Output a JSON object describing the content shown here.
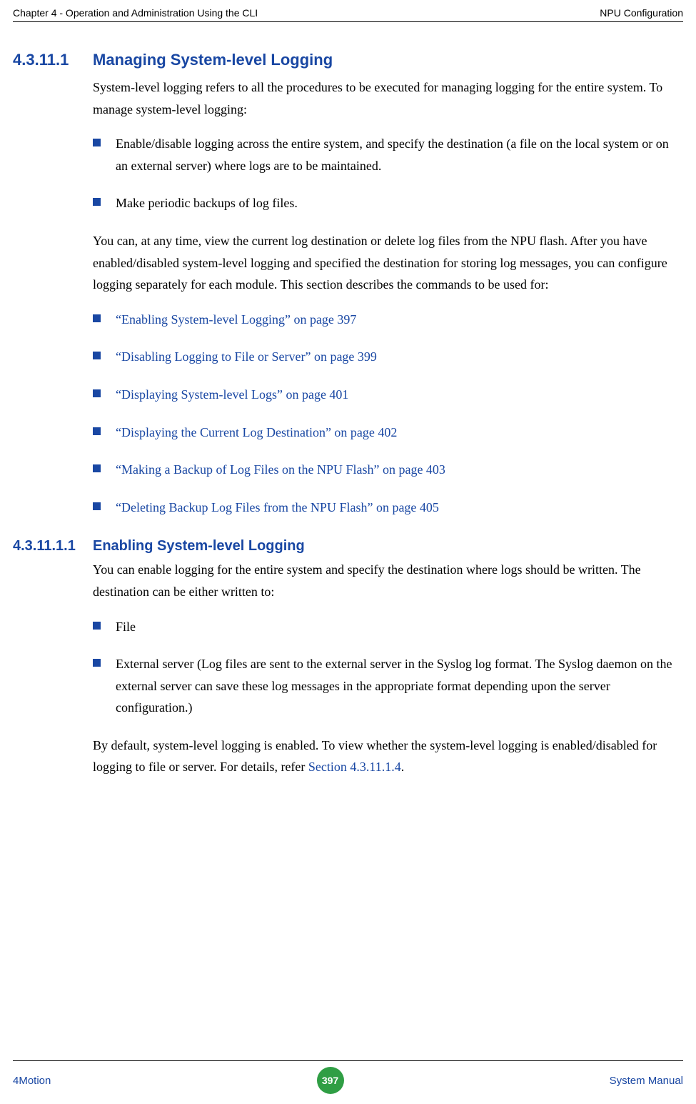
{
  "header": {
    "left": "Chapter 4 - Operation and Administration Using the CLI",
    "right": "NPU Configuration"
  },
  "section1": {
    "num": "4.3.11.1",
    "title": "Managing System-level Logging",
    "intro": "System-level logging refers to all the procedures to be executed for managing logging for the entire system. To manage system-level logging:",
    "steps": [
      "Enable/disable logging across the entire system, and specify the destination (a file on the local system or on an external server) where logs are to be maintained.",
      "Make periodic backups of log files."
    ],
    "para2": "You can, at any time, view the current log destination or delete log files from the NPU flash. After you have enabled/disabled system-level logging and specified the destination for storing log messages, you can configure logging separately for each module. This section describes the commands to be used for:",
    "links": [
      "“Enabling System-level Logging” on page 397",
      "“Disabling Logging to File or Server” on page 399",
      "“Displaying System-level Logs” on page 401",
      "“Displaying the Current Log Destination” on page 402",
      "“Making a Backup of Log Files on the NPU Flash” on page 403",
      "“Deleting Backup Log Files from the NPU Flash” on page 405"
    ]
  },
  "section2": {
    "num": "4.3.11.1.1",
    "title": "Enabling System-level Logging",
    "intro": "You can enable logging for the entire system and specify the destination where logs should be written. The destination can be either written to:",
    "dests": [
      "File",
      "External server (Log files are sent to the external server in the Syslog log format. The Syslog daemon on the external server can save these log messages in the appropriate format depending upon the server configuration.)"
    ],
    "para2_prefix": "By default, system-level logging is enabled. To view whether the system-level logging is enabled/disabled for logging to file or server. For details, refer ",
    "para2_xref": "Section 4.3.11.1.4",
    "para2_suffix": "."
  },
  "footer": {
    "left": "4Motion",
    "page": "397",
    "right": "System Manual"
  }
}
